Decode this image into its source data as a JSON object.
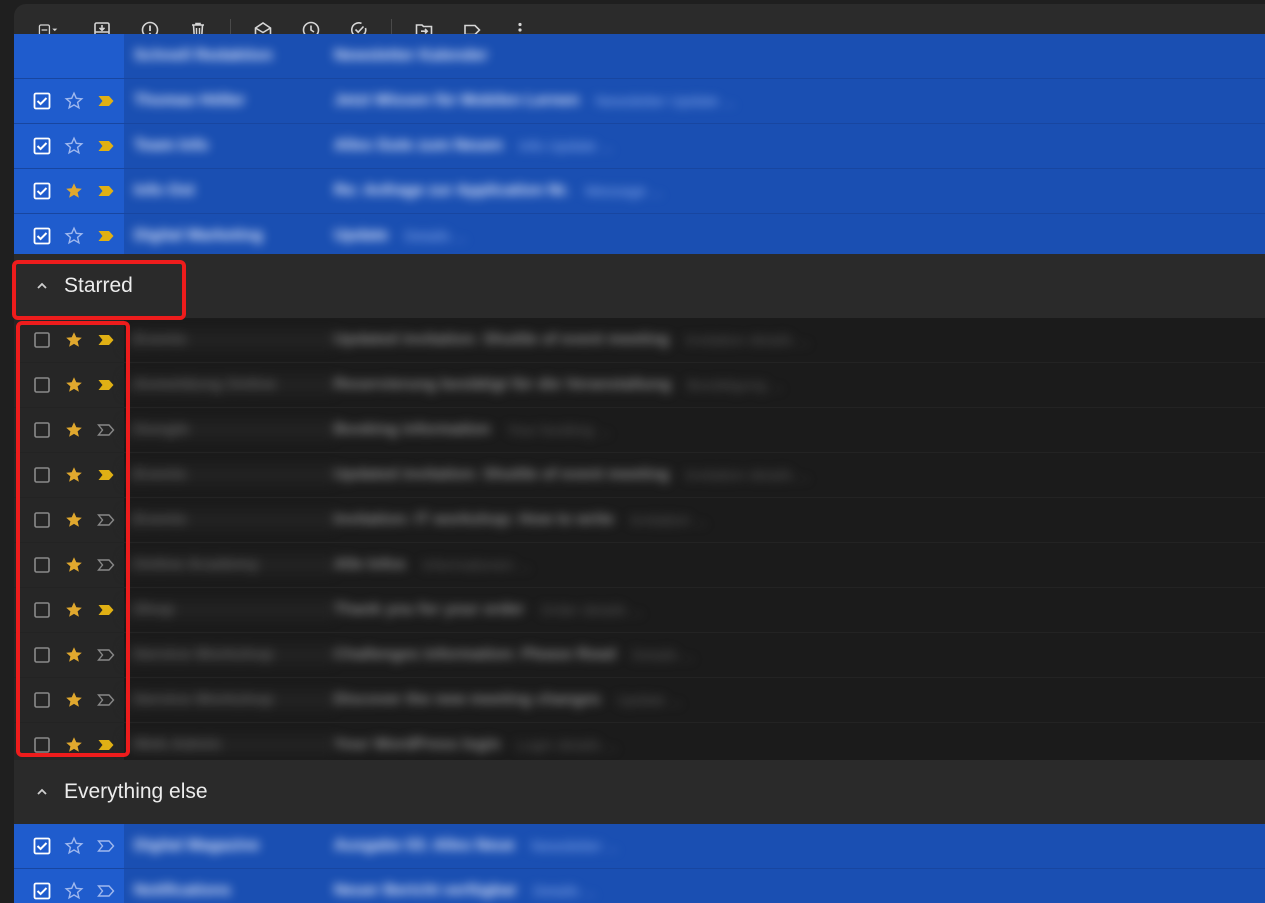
{
  "toolbar": {
    "icons": [
      "select-checkbox-icon",
      "chevron-down-icon",
      "archive-icon",
      "report-spam-icon",
      "delete-icon",
      "mark-as-read-icon",
      "snooze-icon",
      "add-to-tasks-icon",
      "move-to-icon",
      "label-icon",
      "more-vert-icon"
    ]
  },
  "colors": {
    "selected_row": "#1a4fb2",
    "star_gold": "#e0a82e",
    "important_gold": "#e0b014",
    "highlight": "#ee1c1c",
    "section_bg": "#2a2a2a"
  },
  "top_rows": [
    {
      "checked": true,
      "starred": false,
      "important": true,
      "sender": "Thomas Höller",
      "subject": "Jetzt Wissen für Mobilen Lernen",
      "snippet": "Newsletter Update ..."
    },
    {
      "checked": true,
      "starred": false,
      "important": true,
      "sender": "Team Info",
      "subject": "Alles Gute zum Neuen",
      "snippet": "Info Update ..."
    },
    {
      "checked": true,
      "starred": true,
      "important": true,
      "sender": "Info Ost",
      "subject": "Re: Anfrage zur Application Nr.",
      "snippet": "Message ..."
    },
    {
      "checked": true,
      "starred": false,
      "important": true,
      "sender": "Digital Marketing",
      "subject": "Update",
      "snippet": "Details ..."
    }
  ],
  "starred_section": {
    "label": "Starred",
    "rows": [
      {
        "checked": false,
        "starred": true,
        "important": true,
        "sender": "Events",
        "subject": "Updated invitation: Shuttle of event meeting",
        "snippet": "Invitation details ..."
      },
      {
        "checked": false,
        "starred": true,
        "important": true,
        "sender": "Anmeldung Online",
        "subject": "Reservierung bestätigt für die Veranstaltung",
        "snippet": "Bestätigung ..."
      },
      {
        "checked": false,
        "starred": true,
        "important": false,
        "sender": "Google",
        "subject": "Booking information",
        "snippet": "Your booking ..."
      },
      {
        "checked": false,
        "starred": true,
        "important": true,
        "sender": "Events",
        "subject": "Updated invitation: Shuttle of event meeting",
        "snippet": "Invitation details ..."
      },
      {
        "checked": false,
        "starred": true,
        "important": false,
        "sender": "Events",
        "subject": "Invitation: IT workshop: How to write",
        "snippet": "Invitation ..."
      },
      {
        "checked": false,
        "starred": true,
        "important": false,
        "sender": "Online Academy",
        "subject": "Alle Infos",
        "snippet": "Informationen ..."
      },
      {
        "checked": false,
        "starred": true,
        "important": true,
        "sender": "Shop",
        "subject": "Thank you for your order",
        "snippet": "Order details ..."
      },
      {
        "checked": false,
        "starred": true,
        "important": false,
        "sender": "Service Workshop",
        "subject": "Challenges information: Please Read",
        "snippet": "Details ..."
      },
      {
        "checked": false,
        "starred": true,
        "important": false,
        "sender": "Service Workshop",
        "subject": "Discover the new meeting changes",
        "snippet": "Update ..."
      },
      {
        "checked": false,
        "starred": true,
        "important": true,
        "sender": "Web Admin",
        "subject": "Your WordPress login",
        "snippet": "Login details ..."
      }
    ]
  },
  "everything_else_section": {
    "label": "Everything else",
    "rows": [
      {
        "checked": true,
        "starred": false,
        "important": false,
        "sender": "Digital Magazine",
        "subject": "Ausgabe 03: Alles Neue",
        "snippet": "Newsletter ..."
      },
      {
        "checked": true,
        "starred": false,
        "important": false,
        "sender": "Notifications",
        "subject": "Neuer Bericht verfügbar",
        "snippet": "Details ..."
      }
    ]
  }
}
